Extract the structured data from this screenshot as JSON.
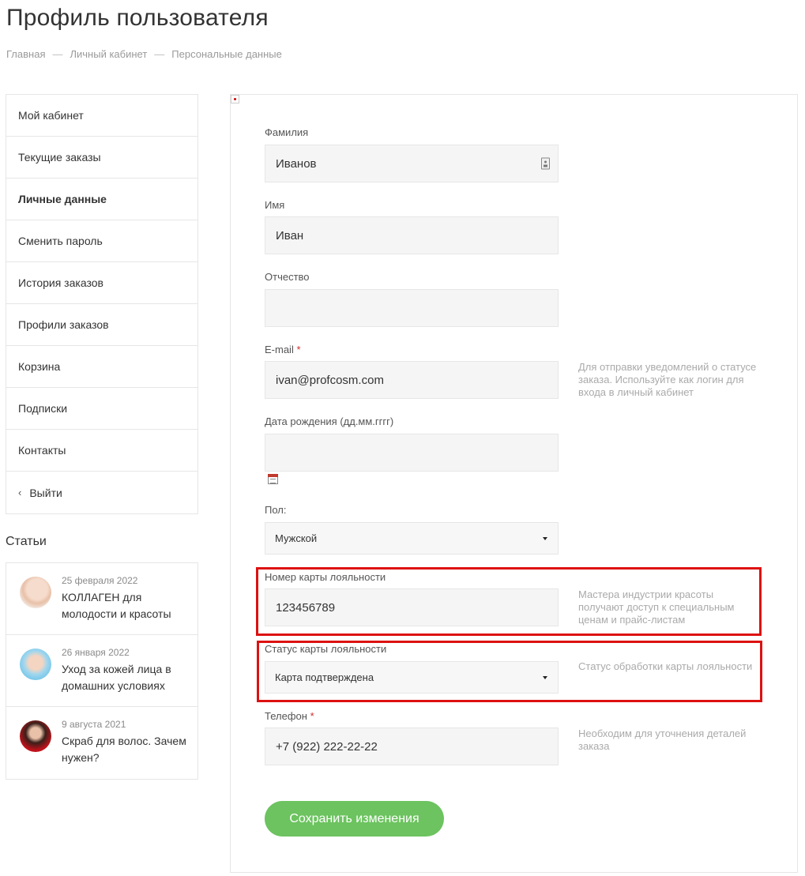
{
  "page": {
    "title": "Профиль пользователя",
    "breadcrumb": [
      "Главная",
      "Личный кабинет",
      "Персональные данные"
    ],
    "breadcrumb_separator": "—"
  },
  "sidebar": {
    "items": [
      {
        "label": "Мой кабинет"
      },
      {
        "label": "Текущие заказы"
      },
      {
        "label": "Личные данные",
        "active": true
      },
      {
        "label": "Сменить пароль"
      },
      {
        "label": "История заказов"
      },
      {
        "label": "Профили заказов"
      },
      {
        "label": "Корзина"
      },
      {
        "label": "Подписки"
      },
      {
        "label": "Контакты"
      },
      {
        "label": "Выйти",
        "icon": "chevron-left-icon"
      }
    ]
  },
  "articles": {
    "title": "Статьи",
    "items": [
      {
        "date": "25 февраля 2022",
        "title": "КОЛЛАГЕН для молодости и красоты"
      },
      {
        "date": "26 января 2022",
        "title": "Уход за кожей лица в домашних условиях"
      },
      {
        "date": "9 августа 2021",
        "title": "Скраб для волос. Зачем нужен?"
      }
    ]
  },
  "form": {
    "last_name": {
      "label": "Фамилия",
      "value": "Иванов",
      "icon": "contact-card-icon"
    },
    "first_name": {
      "label": "Имя",
      "value": "Иван"
    },
    "middle_name": {
      "label": "Отчество",
      "value": ""
    },
    "email": {
      "label": "E-mail",
      "required_mark": "*",
      "value": "ivan@profcosm.com",
      "hint": "Для отправки уведомлений о статусе заказа. Используйте как логин для входа в личный кабинет"
    },
    "birthdate": {
      "label": "Дата рождения (дд.мм.гггг)",
      "value": "",
      "icon": "calendar-icon"
    },
    "gender": {
      "label": "Пол:",
      "value": "Мужской"
    },
    "loyalty_card": {
      "label": "Номер карты лояльности",
      "value": "123456789",
      "hint": "Мастера индустрии красоты получают доступ к специальным ценам и прайс-листам"
    },
    "loyalty_status": {
      "label": "Статус карты лояльности",
      "value": "Карта подтверждена",
      "hint": "Статус обработки карты лояльности"
    },
    "phone": {
      "label": "Телефон",
      "required_mark": "*",
      "value": "+7 (922) 222-22-22",
      "hint": "Необходим для уточнения деталей заказа"
    },
    "save_label": "Сохранить изменения"
  },
  "colors": {
    "accent": "#6cc35f",
    "highlight": "#dd1111",
    "required": "#d52b2b"
  }
}
